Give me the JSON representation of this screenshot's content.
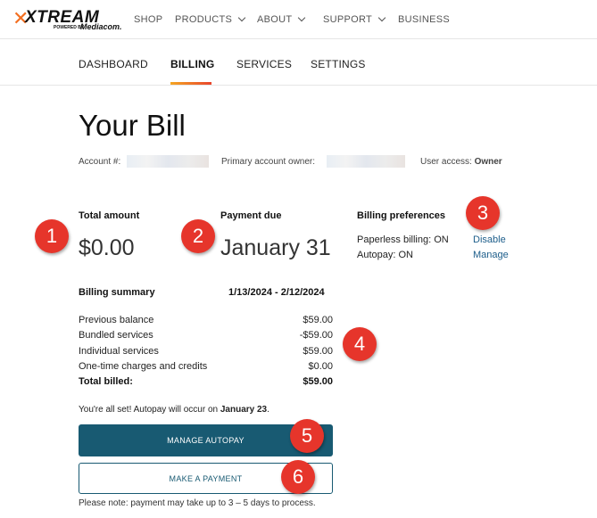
{
  "brand": {
    "logo_main": "XTREAM",
    "logo_powered": "POWERED BY",
    "logo_sub": "Mediacom."
  },
  "topnav": {
    "items": [
      "SHOP",
      "PRODUCTS",
      "ABOUT",
      "SUPPORT",
      "BUSINESS"
    ]
  },
  "subnav": {
    "items": [
      "DASHBOARD",
      "BILLING",
      "SERVICES",
      "SETTINGS"
    ],
    "active": "BILLING"
  },
  "page": {
    "title": "Your Bill",
    "account_label": "Account #:",
    "owner_label": "Primary account owner:",
    "access_label": "User access:",
    "access_value": "Owner"
  },
  "total": {
    "label": "Total amount",
    "value": "$0.00"
  },
  "due": {
    "label": "Payment due",
    "value": "January 31"
  },
  "prefs": {
    "label": "Billing preferences",
    "paperless_label": "Paperless billing: ON",
    "paperless_action": "Disable",
    "autopay_label": "Autopay: ON",
    "autopay_action": "Manage"
  },
  "summary": {
    "label": "Billing summary",
    "period": "1/13/2024 - 2/12/2024",
    "rows": [
      {
        "label": "Previous balance",
        "value": "$59.00"
      },
      {
        "label": "Bundled services",
        "value": "-$59.00"
      },
      {
        "label": "Individual services",
        "value": "$59.00"
      },
      {
        "label": "One-time charges and credits",
        "value": "$0.00"
      }
    ],
    "total_label": "Total billed:",
    "total_value": "$59.00"
  },
  "autopay_note": {
    "prefix": "You're all set! Autopay will occur on ",
    "date": "January 23",
    "suffix": "."
  },
  "buttons": {
    "manage_autopay": "MANAGE AUTOPAY",
    "make_payment": "MAKE A PAYMENT"
  },
  "footnote": "Please note: payment may take up to 3 – 5 days to process.",
  "markers": [
    "1",
    "2",
    "3",
    "4",
    "5",
    "6"
  ],
  "colors": {
    "accent": "#f36f21",
    "primary_button": "#185a72",
    "link": "#1c5d8a",
    "marker": "#e6352b"
  }
}
